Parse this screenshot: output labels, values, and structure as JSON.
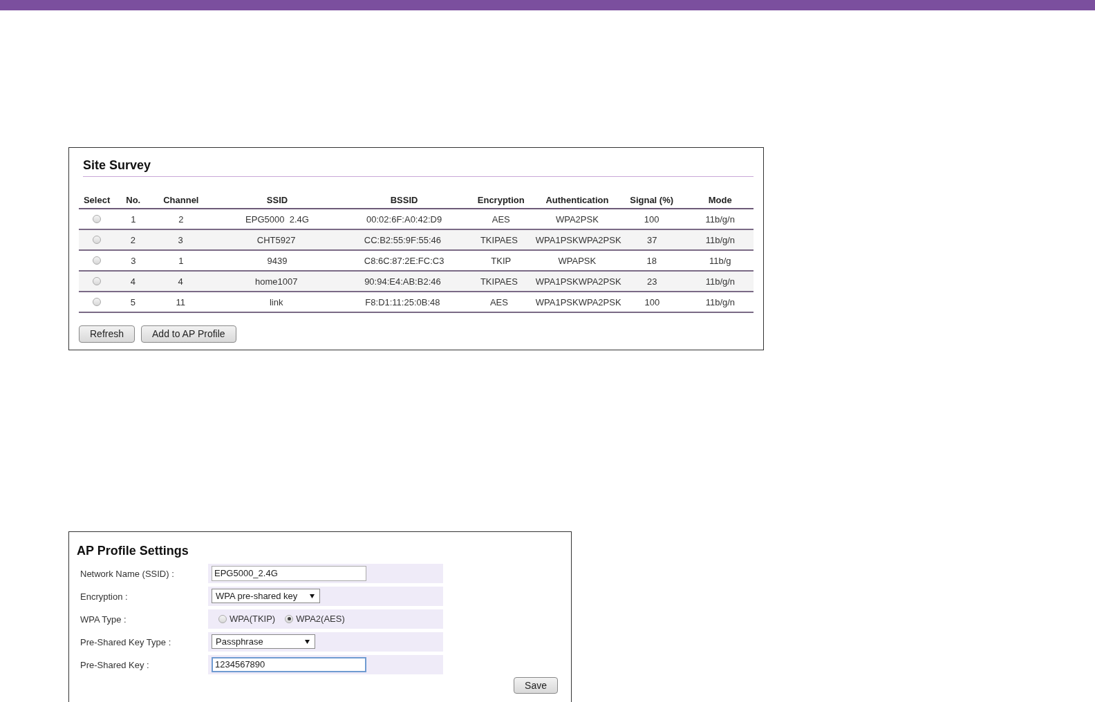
{
  "site_survey": {
    "title": "Site Survey",
    "columns": [
      "Select",
      "No.",
      "Channel",
      "SSID",
      "BSSID",
      "Encryption",
      "Authentication",
      "Signal (%)",
      "Mode"
    ],
    "rows": [
      {
        "selected": false,
        "cells": [
          "",
          "1",
          "2",
          "EPG5000  2.4G",
          "00:02:6F:A0:42:D9",
          "AES",
          "WPA2PSK",
          "100",
          "11b/g/n"
        ]
      },
      {
        "selected": false,
        "cells": [
          "",
          "2",
          "3",
          "CHT5927",
          "CC:B2:55:9F:55:46",
          "TKIPAES",
          "WPA1PSKWPA2PSK",
          "37",
          "11b/g/n"
        ]
      },
      {
        "selected": false,
        "cells": [
          "",
          "3",
          "1",
          "9439",
          "C8:6C:87:2E:FC:C3",
          "TKIP",
          "WPAPSK",
          "18",
          "11b/g"
        ]
      },
      {
        "selected": false,
        "cells": [
          "",
          "4",
          "4",
          "home1007",
          "90:94:E4:AB:B2:46",
          "TKIPAES",
          "WPA1PSKWPA2PSK",
          "23",
          "11b/g/n"
        ]
      },
      {
        "selected": false,
        "cells": [
          "",
          "5",
          "11",
          "link",
          "F8:D1:11:25:0B:48",
          "AES",
          "WPA1PSKWPA2PSK",
          "100",
          "11b/g/n"
        ]
      }
    ],
    "buttons": [
      "Refresh",
      "Add to AP Profile"
    ]
  },
  "ap_profile": {
    "title": "AP Profile Settings",
    "fields": [
      {
        "kind": "text",
        "label": "Network Name (SSID) :",
        "value": "EPG5000_2.4G",
        "focused": false
      },
      {
        "kind": "select",
        "label": "Encryption :",
        "value": "WPA pre-shared key"
      },
      {
        "kind": "radio",
        "label": "WPA Type :",
        "options": [
          {
            "label": "WPA(TKIP)",
            "selected": false
          },
          {
            "label": "WPA2(AES)",
            "selected": true
          }
        ]
      },
      {
        "kind": "select",
        "label": "Pre-Shared Key Type :",
        "value": "Passphrase"
      },
      {
        "kind": "text",
        "label": "Pre-Shared Key :",
        "value": "1234567890",
        "focused": true
      }
    ],
    "buttons": [
      "Save"
    ]
  }
}
